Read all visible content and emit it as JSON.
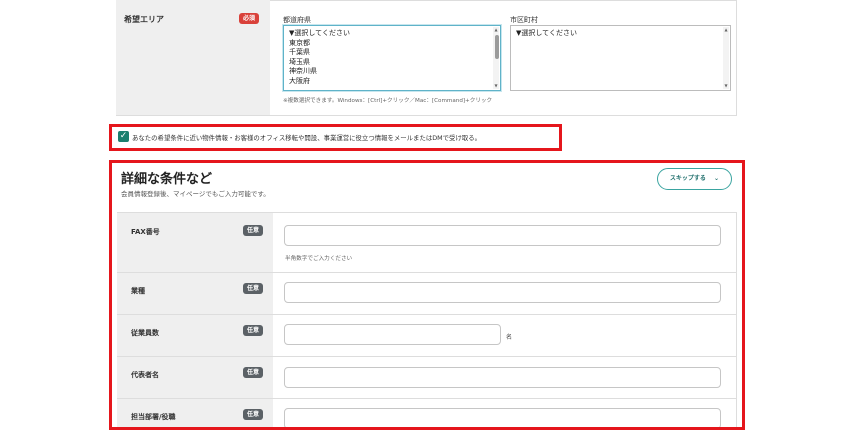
{
  "area": {
    "label": "希望エリア",
    "required_badge": "必須",
    "prefecture_label": "都道府県",
    "city_label": "市区町村",
    "prefecture_options": [
      "▼選択してください",
      "東京都",
      "千葉県",
      "埼玉県",
      "神奈川県",
      "大阪府"
    ],
    "city_options": [
      "▼選択してください"
    ],
    "note": "※複数選択できます。Windows：[Ctrl]+クリック／Mac：[Command]+クリック"
  },
  "consent": {
    "checked": true,
    "text": "あなたの希望条件に近い物件情報・お客様のオフィス移転や開設、事業運営に役立つ情報をメールまたはDMで受け取る。"
  },
  "details": {
    "title": "詳細な条件など",
    "subtitle": "会員情報登録後、マイページでもご入力可能です。",
    "skip_button": "スキップする",
    "optional_badge": "任意",
    "fields": [
      {
        "label": "FAX番号",
        "hint": "半角数字でご入力ください"
      },
      {
        "label": "業種"
      },
      {
        "label": "従業員数",
        "unit": "名"
      },
      {
        "label": "代表者名"
      },
      {
        "label": "担当部署/役職"
      }
    ]
  },
  "colors": {
    "accent_red": "#e5161c",
    "teal": "#1b7f6e",
    "badge_required": "#d9413a",
    "badge_optional": "#5b6166"
  }
}
